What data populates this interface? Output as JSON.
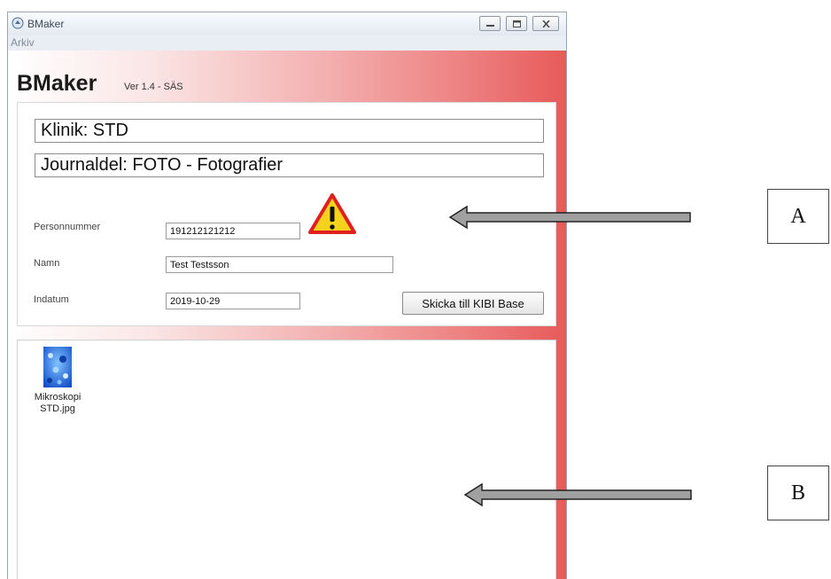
{
  "window": {
    "title": "BMaker",
    "menu": [
      "Arkiv"
    ]
  },
  "header": {
    "app_name": "BMaker",
    "version": "Ver 1.4  -  SÄS"
  },
  "info": {
    "klinik": "Klinik: STD",
    "journaldel": "Journaldel: FOTO - Fotografier"
  },
  "form": {
    "personnummer_label": "Personnummer",
    "personnummer_value": "191212121212",
    "namn_label": "Namn",
    "namn_value": "Test Testsson",
    "indatum_label": "Indatum",
    "indatum_value": "2019-10-29",
    "send_button": "Skicka till KIBI Base"
  },
  "files": [
    {
      "name_line1": "Mikroskopi",
      "name_line2": "STD.jpg"
    }
  ],
  "annotations": {
    "a": "A",
    "b": "B"
  },
  "colors": {
    "accent_red": "#e85a5a",
    "warning_fill": "#f5d21c",
    "warning_border": "#e02020"
  }
}
